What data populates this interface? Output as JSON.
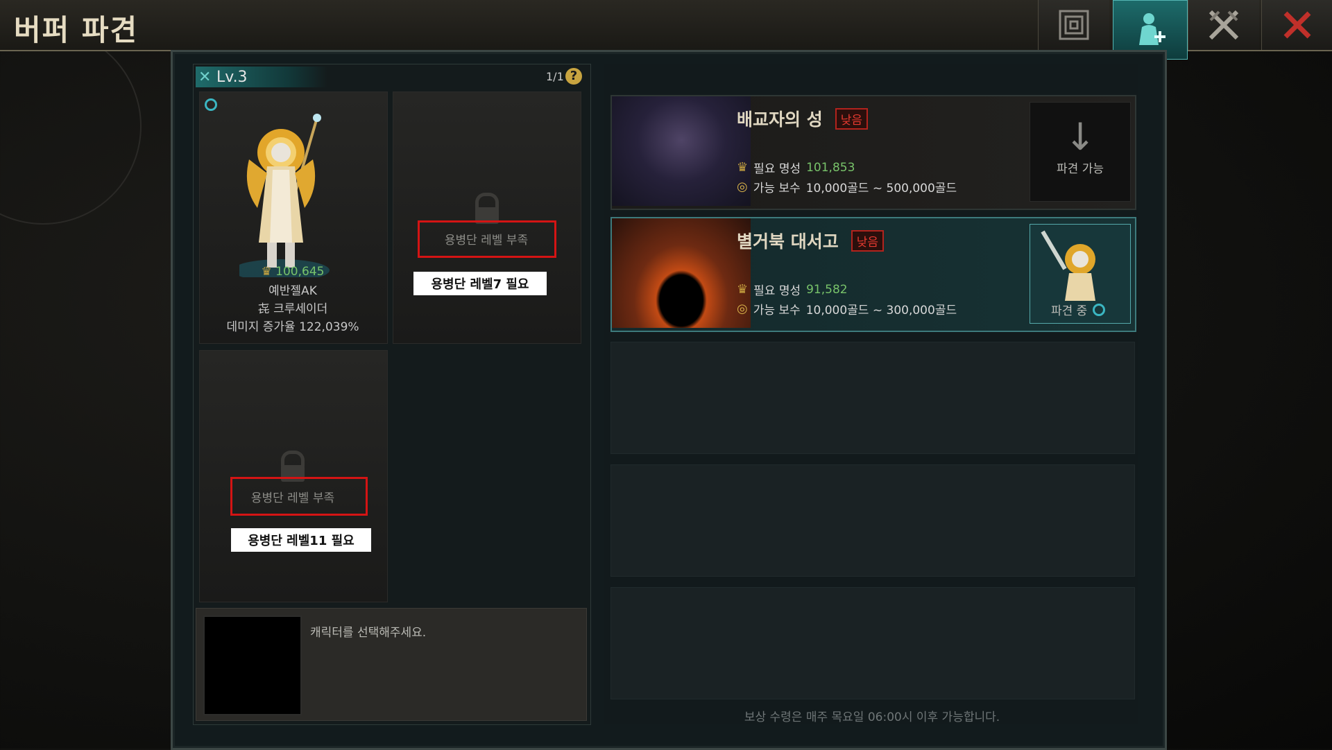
{
  "header": {
    "title": "버퍼 파견"
  },
  "toolbar": {
    "map_icon": "maze-map-icon",
    "buffer_icon": "buffer-dispatch-icon",
    "swords_icon": "crossed-swords-icon",
    "close_icon": "close-icon"
  },
  "colors": {
    "accent": "#1d6b6a",
    "warning_red": "#d41414",
    "fame_green": "#78c36a"
  },
  "party": {
    "level": "Lv.3",
    "page": "1/1",
    "help": "?",
    "slots": [
      {
        "character": {
          "fame": "100,645",
          "name": "예반젤AK",
          "class": "크루세이더",
          "damage_label": "데미지 증가율",
          "damage_value": "122,039%"
        }
      },
      {
        "locked_label": "용병단 레벨 부족",
        "note": "용병단 레벨7 필요"
      },
      {
        "locked_label": "용병단 레벨 부족",
        "note": "용병단 레벨11 필요"
      }
    ],
    "info_text": "캐릭터를 선택해주세요."
  },
  "dungeons": [
    {
      "name": "배교자의 성",
      "badge": "낮음",
      "fame_label": "필요 명성",
      "fame_value": "101,853",
      "reward_label": "가능 보수",
      "reward_value": "10,000골드 ~ 500,000골드",
      "action": "파견 가능"
    },
    {
      "name": "별거북 대서고",
      "badge": "낮음",
      "fame_label": "필요 명성",
      "fame_value": "91,582",
      "reward_label": "가능 보수",
      "reward_value": "10,000골드 ~ 300,000골드",
      "action": "파견 중"
    }
  ],
  "footer_note": "보상 수령은 매주 목요일 06:00시 이후 가능합니다."
}
